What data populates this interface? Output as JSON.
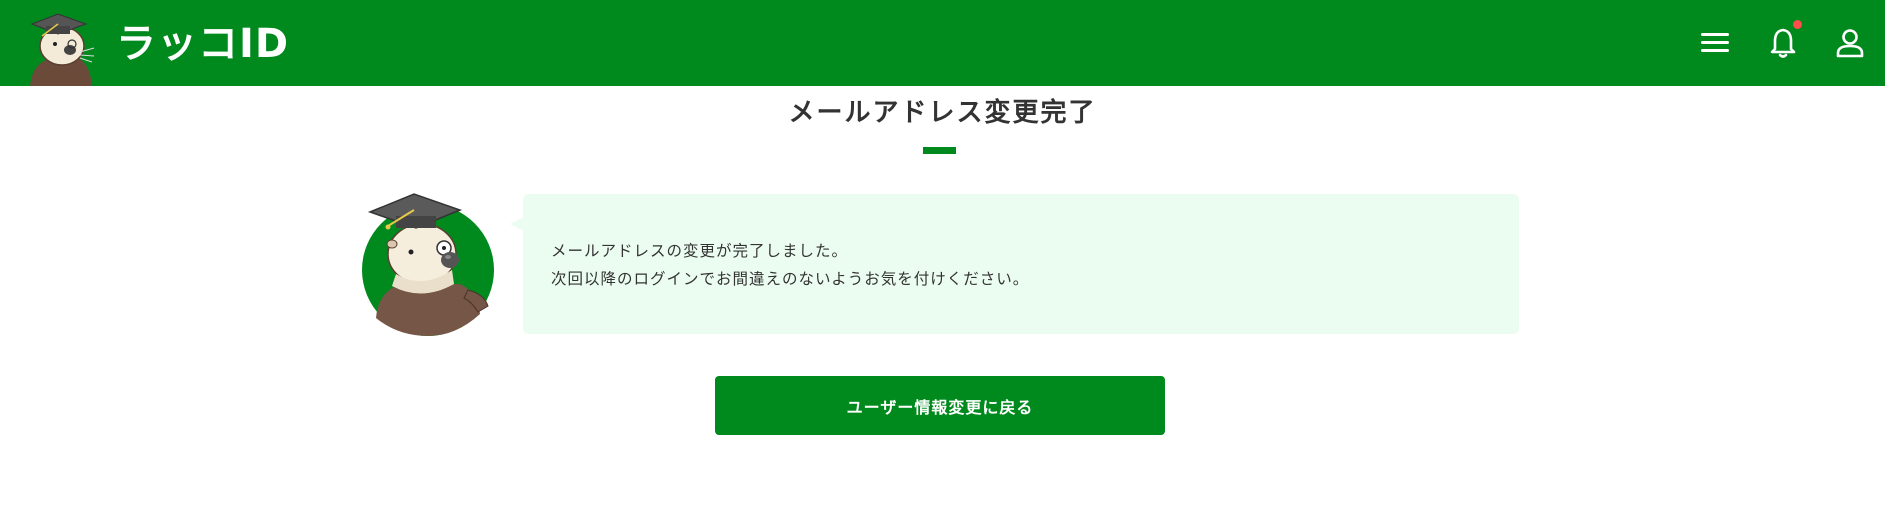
{
  "header": {
    "logo_text": "ラッコID",
    "logo_icon": "sea-otter-mascot-icon",
    "menu_icon": "hamburger-menu-icon",
    "notification_icon": "bell-icon",
    "user_icon": "user-icon",
    "has_unread_notification": true
  },
  "main": {
    "title": "メールアドレス変更完了",
    "avatar_icon": "sea-otter-professor-avatar",
    "message": {
      "line1": "メールアドレスの変更が完了しました。",
      "line2": "次回以降のログインでお間違えのないようお気を付けください。"
    },
    "back_button_label": "ユーザー情報変更に戻る"
  },
  "colors": {
    "brand_green": "#008a1e",
    "bubble_background": "#ebfdf0",
    "notification_dot": "#ff4d4d",
    "text": "#333333"
  }
}
